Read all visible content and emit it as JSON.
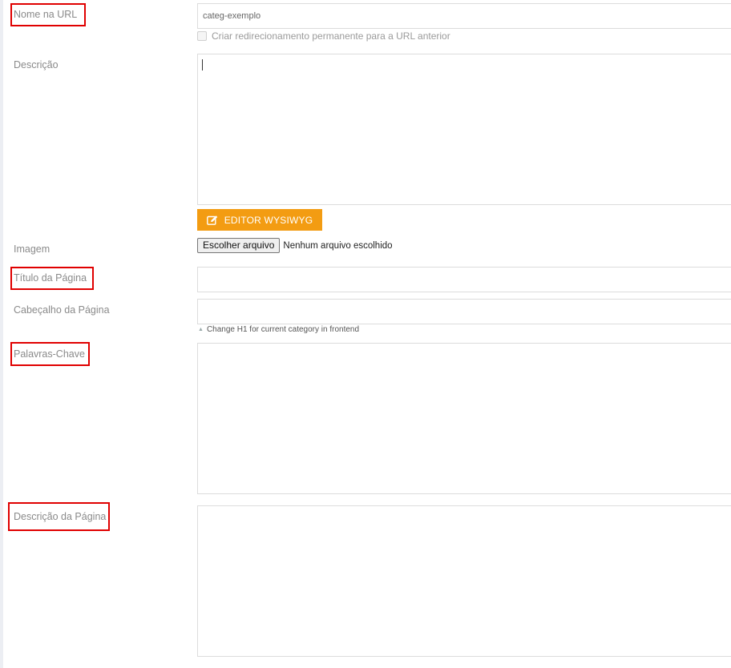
{
  "fields": {
    "url_name": {
      "label": "Nome na URL",
      "value": "categ-exemplo"
    },
    "redirect": {
      "label": "Criar redirecionamento permanente para a URL anterior",
      "checked": false
    },
    "description": {
      "label": "Descrição",
      "value": ""
    },
    "wysiwyg_button": {
      "label": "EDITOR WYSIWYG",
      "icon": "edit-icon",
      "color": "#f39c12"
    },
    "image": {
      "label": "Imagem",
      "button": "Escolher arquivo",
      "status": "Nenhum arquivo escolhido"
    },
    "page_title": {
      "label": "Título da Página",
      "value": ""
    },
    "page_header": {
      "label": "Cabeçalho da Página",
      "value": "",
      "hint": "Change H1 for current category in frontend"
    },
    "keywords": {
      "label": "Palavras-Chave",
      "value": ""
    },
    "page_description": {
      "label": "Descrição da Página",
      "value": ""
    }
  },
  "highlight_color": "#e00000"
}
